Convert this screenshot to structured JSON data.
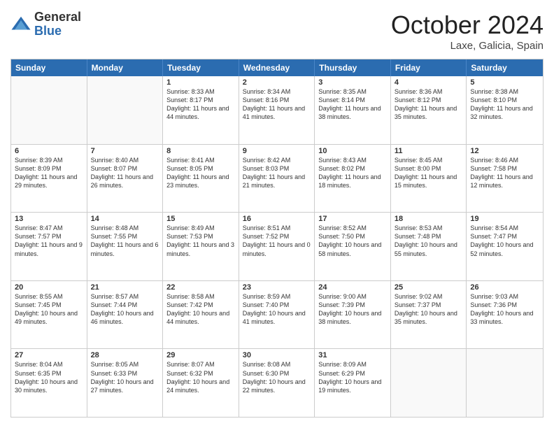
{
  "header": {
    "logo_general": "General",
    "logo_blue": "Blue",
    "month_title": "October 2024",
    "location": "Laxe, Galicia, Spain"
  },
  "calendar": {
    "days_of_week": [
      "Sunday",
      "Monday",
      "Tuesday",
      "Wednesday",
      "Thursday",
      "Friday",
      "Saturday"
    ],
    "rows": [
      [
        {
          "day": "",
          "info": "",
          "empty": true
        },
        {
          "day": "",
          "info": "",
          "empty": true
        },
        {
          "day": "1",
          "info": "Sunrise: 8:33 AM\nSunset: 8:17 PM\nDaylight: 11 hours and 44 minutes."
        },
        {
          "day": "2",
          "info": "Sunrise: 8:34 AM\nSunset: 8:16 PM\nDaylight: 11 hours and 41 minutes."
        },
        {
          "day": "3",
          "info": "Sunrise: 8:35 AM\nSunset: 8:14 PM\nDaylight: 11 hours and 38 minutes."
        },
        {
          "day": "4",
          "info": "Sunrise: 8:36 AM\nSunset: 8:12 PM\nDaylight: 11 hours and 35 minutes."
        },
        {
          "day": "5",
          "info": "Sunrise: 8:38 AM\nSunset: 8:10 PM\nDaylight: 11 hours and 32 minutes."
        }
      ],
      [
        {
          "day": "6",
          "info": "Sunrise: 8:39 AM\nSunset: 8:09 PM\nDaylight: 11 hours and 29 minutes."
        },
        {
          "day": "7",
          "info": "Sunrise: 8:40 AM\nSunset: 8:07 PM\nDaylight: 11 hours and 26 minutes."
        },
        {
          "day": "8",
          "info": "Sunrise: 8:41 AM\nSunset: 8:05 PM\nDaylight: 11 hours and 23 minutes."
        },
        {
          "day": "9",
          "info": "Sunrise: 8:42 AM\nSunset: 8:03 PM\nDaylight: 11 hours and 21 minutes."
        },
        {
          "day": "10",
          "info": "Sunrise: 8:43 AM\nSunset: 8:02 PM\nDaylight: 11 hours and 18 minutes."
        },
        {
          "day": "11",
          "info": "Sunrise: 8:45 AM\nSunset: 8:00 PM\nDaylight: 11 hours and 15 minutes."
        },
        {
          "day": "12",
          "info": "Sunrise: 8:46 AM\nSunset: 7:58 PM\nDaylight: 11 hours and 12 minutes."
        }
      ],
      [
        {
          "day": "13",
          "info": "Sunrise: 8:47 AM\nSunset: 7:57 PM\nDaylight: 11 hours and 9 minutes."
        },
        {
          "day": "14",
          "info": "Sunrise: 8:48 AM\nSunset: 7:55 PM\nDaylight: 11 hours and 6 minutes."
        },
        {
          "day": "15",
          "info": "Sunrise: 8:49 AM\nSunset: 7:53 PM\nDaylight: 11 hours and 3 minutes."
        },
        {
          "day": "16",
          "info": "Sunrise: 8:51 AM\nSunset: 7:52 PM\nDaylight: 11 hours and 0 minutes."
        },
        {
          "day": "17",
          "info": "Sunrise: 8:52 AM\nSunset: 7:50 PM\nDaylight: 10 hours and 58 minutes."
        },
        {
          "day": "18",
          "info": "Sunrise: 8:53 AM\nSunset: 7:48 PM\nDaylight: 10 hours and 55 minutes."
        },
        {
          "day": "19",
          "info": "Sunrise: 8:54 AM\nSunset: 7:47 PM\nDaylight: 10 hours and 52 minutes."
        }
      ],
      [
        {
          "day": "20",
          "info": "Sunrise: 8:55 AM\nSunset: 7:45 PM\nDaylight: 10 hours and 49 minutes."
        },
        {
          "day": "21",
          "info": "Sunrise: 8:57 AM\nSunset: 7:44 PM\nDaylight: 10 hours and 46 minutes."
        },
        {
          "day": "22",
          "info": "Sunrise: 8:58 AM\nSunset: 7:42 PM\nDaylight: 10 hours and 44 minutes."
        },
        {
          "day": "23",
          "info": "Sunrise: 8:59 AM\nSunset: 7:40 PM\nDaylight: 10 hours and 41 minutes."
        },
        {
          "day": "24",
          "info": "Sunrise: 9:00 AM\nSunset: 7:39 PM\nDaylight: 10 hours and 38 minutes."
        },
        {
          "day": "25",
          "info": "Sunrise: 9:02 AM\nSunset: 7:37 PM\nDaylight: 10 hours and 35 minutes."
        },
        {
          "day": "26",
          "info": "Sunrise: 9:03 AM\nSunset: 7:36 PM\nDaylight: 10 hours and 33 minutes."
        }
      ],
      [
        {
          "day": "27",
          "info": "Sunrise: 8:04 AM\nSunset: 6:35 PM\nDaylight: 10 hours and 30 minutes."
        },
        {
          "day": "28",
          "info": "Sunrise: 8:05 AM\nSunset: 6:33 PM\nDaylight: 10 hours and 27 minutes."
        },
        {
          "day": "29",
          "info": "Sunrise: 8:07 AM\nSunset: 6:32 PM\nDaylight: 10 hours and 24 minutes."
        },
        {
          "day": "30",
          "info": "Sunrise: 8:08 AM\nSunset: 6:30 PM\nDaylight: 10 hours and 22 minutes."
        },
        {
          "day": "31",
          "info": "Sunrise: 8:09 AM\nSunset: 6:29 PM\nDaylight: 10 hours and 19 minutes."
        },
        {
          "day": "",
          "info": "",
          "empty": true
        },
        {
          "day": "",
          "info": "",
          "empty": true
        }
      ]
    ]
  }
}
